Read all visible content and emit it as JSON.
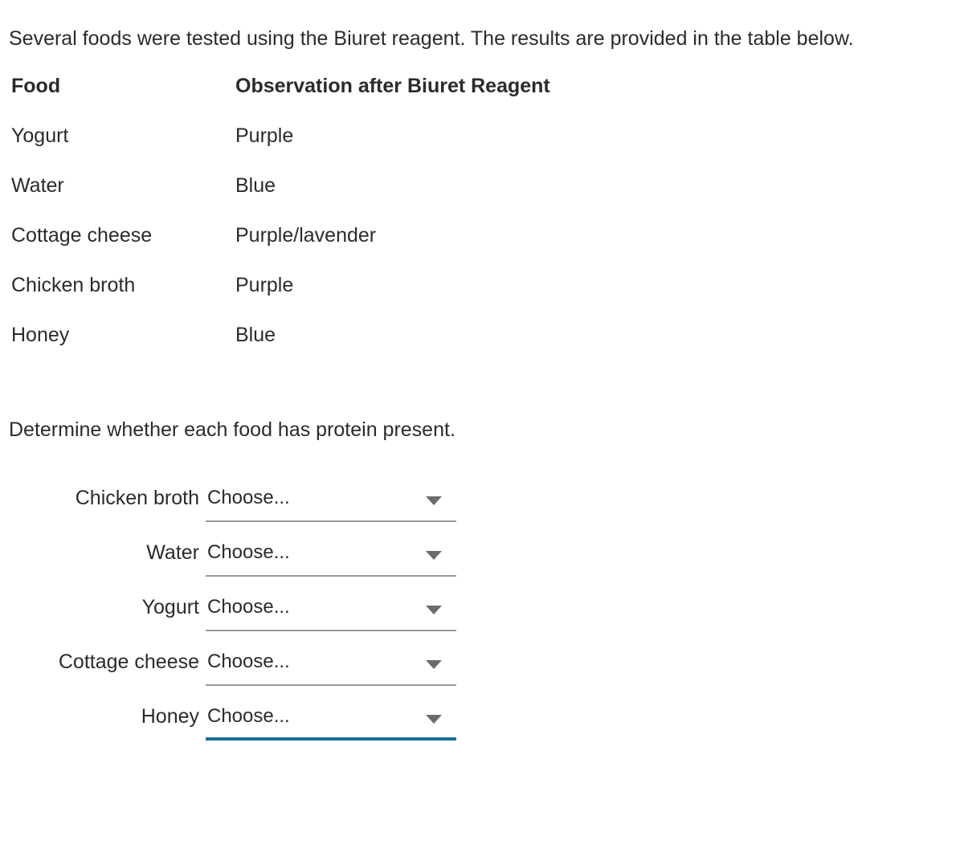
{
  "intro": {
    "text": "Several foods were tested using the Biuret reagent. The results are provided in the table below."
  },
  "results_table": {
    "headers": {
      "food": "Food",
      "observation": "Observation after Biuret Reagent"
    },
    "rows": [
      {
        "food": "Yogurt",
        "observation": "Purple"
      },
      {
        "food": "Water",
        "observation": "Blue"
      },
      {
        "food": "Cottage cheese",
        "observation": "Purple/lavender"
      },
      {
        "food": "Chicken broth",
        "observation": "Purple"
      },
      {
        "food": "Honey",
        "observation": "Blue"
      }
    ]
  },
  "prompt": {
    "text": "Determine whether each food has protein present."
  },
  "dropdowns": {
    "placeholder": "Choose...",
    "focus_color": "#1a6e96",
    "underline_color": "#9a9a9a",
    "arrow_icon": "chevron-down-icon",
    "items": [
      {
        "label": "Chicken broth",
        "value": "Choose...",
        "focused": false
      },
      {
        "label": "Water",
        "value": "Choose...",
        "focused": false
      },
      {
        "label": "Yogurt",
        "value": "Choose...",
        "focused": false
      },
      {
        "label": "Cottage cheese",
        "value": "Choose...",
        "focused": false
      },
      {
        "label": "Honey",
        "value": "Choose...",
        "focused": true
      }
    ]
  }
}
